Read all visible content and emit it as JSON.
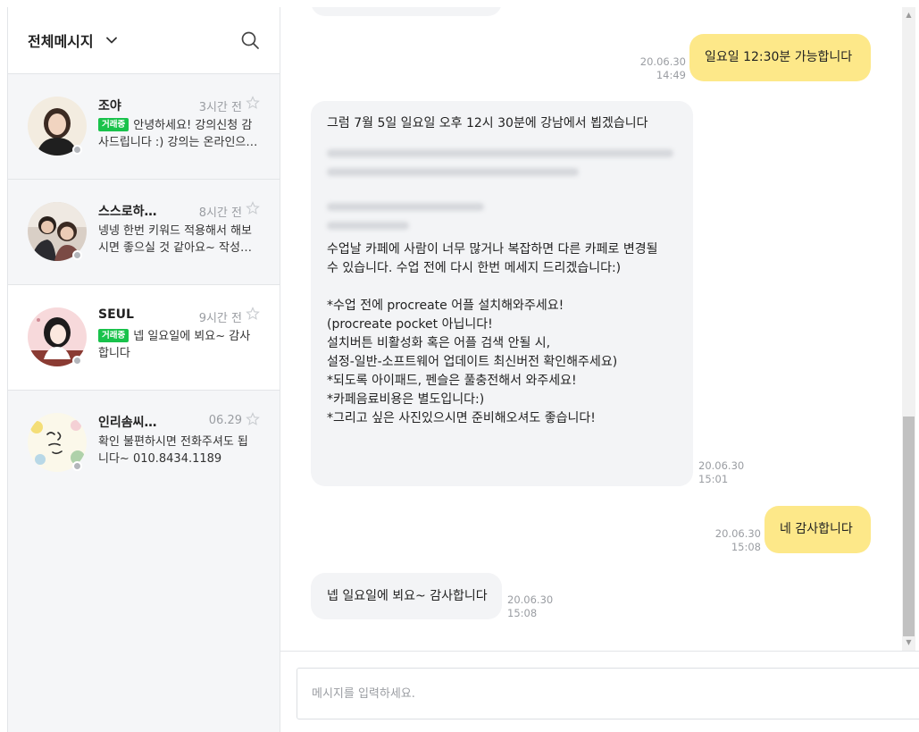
{
  "sidebar": {
    "title": "전체메시지",
    "conversations": [
      {
        "name": "조야",
        "time": "3시간 전",
        "badge": "거래중",
        "preview_line1": "안녕하세요! 강의신청 감",
        "preview_line2": "사드립니다 :) 강의는 온라인으…",
        "active": false
      },
      {
        "name": "스스로하…",
        "time": "8시간 전",
        "preview_line1": "넹넹 한번 키워드 적용해서 해보",
        "preview_line2": "시면 좋으실 것 같아요~ 작성…",
        "active": false
      },
      {
        "name": "SEUL",
        "time": "9시간 전",
        "badge": "거래중",
        "preview_line1": "넵 일요일에 뵈요~ 감사",
        "preview_line2": "합니다",
        "active": true
      },
      {
        "name": "인리솜씨…",
        "time": "06.29",
        "preview_line1": "확인 불편하시면 전화주셔도 됩",
        "preview_line2": "니다~ 010.8434.1189",
        "active": false
      }
    ]
  },
  "chat": {
    "messages": [
      {
        "dir": "out",
        "text": "일요일 12:30분 가능합니다",
        "date": "20.06.30",
        "time": "14:49"
      },
      {
        "dir": "in",
        "date": "20.06.30",
        "time": "15:01",
        "lines_top": [
          "그럼 7월 5일 일요일 오후 12시 30분에 강남에서 뵙겠습니다"
        ],
        "lines_bottom": [
          "수업날 카페에 사람이 너무 많거나 복잡하면 다른 카페로 변경될",
          "수 있습니다. 수업 전에 다시 한번 메세지 드리겠습니다:)",
          "",
          "*수업 전에 procreate 어플 설치해와주세요!",
          "(procreate pocket 아닙니다!",
          "설치버튼 비활성화 혹은 어플 검색 안될 시,",
          "설정-일반-소프트웨어 업데이트 최신버전 확인해주세요)",
          "*되도록 아이패드, 펜슬은 풀충전해서 와주세요!",
          "*카페음료비용은 별도입니다:)",
          "*그리고 싶은 사진있으시면 준비해오셔도 좋습니다!"
        ]
      },
      {
        "dir": "out",
        "text": "네 감사합니다",
        "date": "20.06.30",
        "time": "15:08"
      },
      {
        "dir": "in",
        "text": "넵 일요일에 뵈요~ 감사합니다",
        "date": "20.06.30",
        "time": "15:08"
      }
    ]
  },
  "composer": {
    "placeholder": "메시지를 입력하세요."
  },
  "colors": {
    "accent_badge": "#19c24b",
    "out_bubble": "#fde889",
    "in_bubble": "#f3f4f6"
  },
  "icons": [
    "chevron-down-icon",
    "search-icon",
    "star-icon"
  ]
}
